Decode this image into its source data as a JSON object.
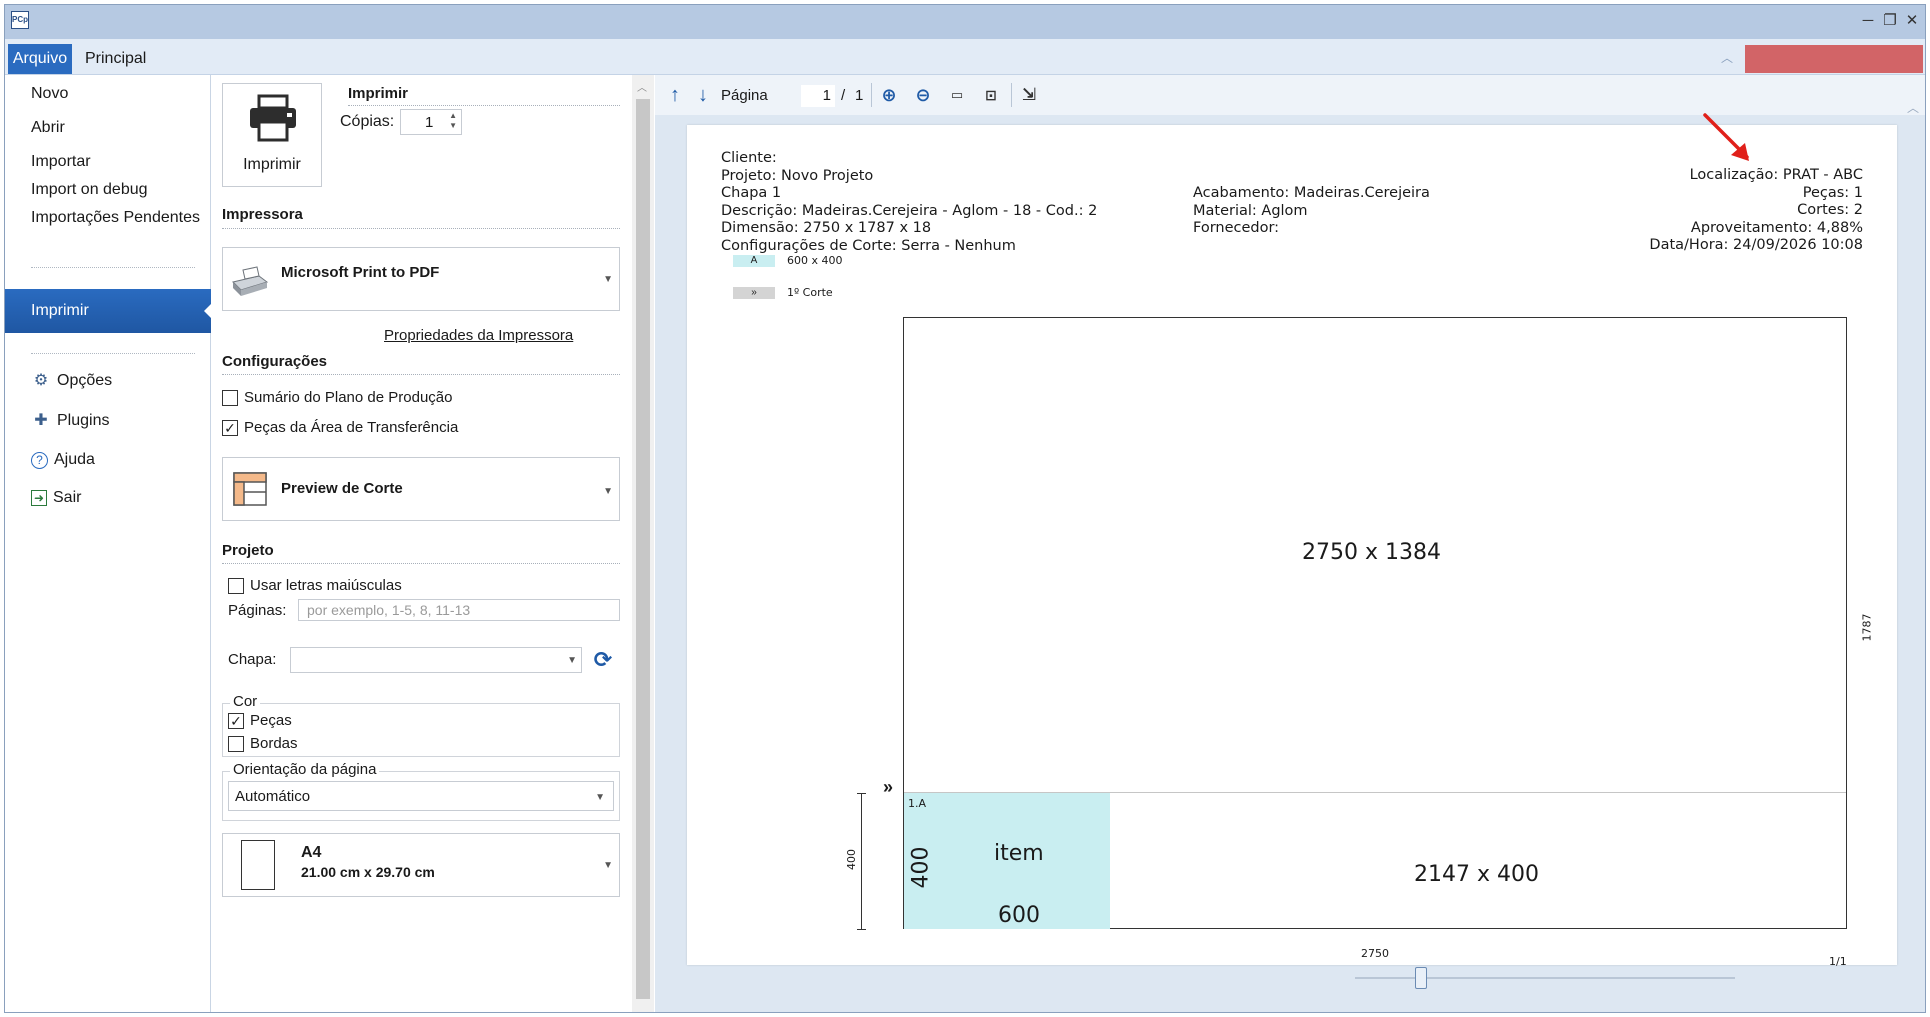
{
  "window": {
    "app_icon_text": "PCp",
    "minimize": "─",
    "restore": "❐",
    "close": "✕"
  },
  "tabs": {
    "arquivo": "Arquivo",
    "principal": "Principal"
  },
  "nav": {
    "novo": "Novo",
    "abrir": "Abrir",
    "importar": "Importar",
    "import_debug": "Import on debug",
    "importacoes_pendentes": "Importações Pendentes",
    "imprimir": "Imprimir",
    "opcoes": "Opções",
    "plugins": "Plugins",
    "ajuda": "Ajuda",
    "sair": "Sair"
  },
  "print_panel": {
    "title": "Imprimir",
    "button_label": "Imprimir",
    "copies_label": "Cópias:",
    "copies_value": "1",
    "printer_heading": "Impressora",
    "printer_name": "Microsoft Print to PDF",
    "printer_properties": "Propriedades da Impressora",
    "config_heading": "Configurações",
    "opt_sumario": "Sumário do Plano de Produção",
    "opt_pecas_transfer": "Peças da Área de Transferência",
    "report_type": "Preview de Corte",
    "project_heading": "Projeto",
    "opt_maiusculas": "Usar letras maiúsculas",
    "paginas_label": "Páginas:",
    "paginas_placeholder": "por exemplo, 1-5, 8, 11-13",
    "chapa_label": "Chapa:",
    "chapa_value": "",
    "cor_title": "Cor",
    "cor_pecas": "Peças",
    "cor_bordas": "Bordas",
    "orientacao_title": "Orientação da página",
    "orientacao_value": "Automático",
    "paper_name": "A4",
    "paper_size": "21.00 cm x 29.70 cm"
  },
  "preview_toolbar": {
    "page_label": "Página",
    "page_current": "1",
    "page_sep": "/",
    "page_total": "1"
  },
  "report": {
    "cliente": "Cliente:",
    "projeto": "Projeto: Novo Projeto",
    "chapa": "Chapa 1",
    "descricao": "Descrição: Madeiras.Cerejeira - Aglom - 18 - Cod.: 2",
    "dimensao": "Dimensão: 2750 x 1787 x 18",
    "config_corte": "Configurações de Corte: Serra - Nenhum",
    "acabamento": "Acabamento: Madeiras.Cerejeira",
    "material": "Material: Aglom",
    "fornecedor": "Fornecedor:",
    "localizacao": "Localização: PRAT - ABC",
    "pecas": "Peças: 1",
    "cortes": "Cortes: 2",
    "aproveitamento": "Aproveitamento: 4,88%",
    "data_hora": "Data/Hora: 24/09/2026 10:08",
    "legend_a_tag": "A",
    "legend_a_text": "600 x 400",
    "legend_cut_tag": "»",
    "legend_cut_text": "1º Corte",
    "region_top_label": "2750 x 1384",
    "region_bottom_label": "2147 x 400",
    "piece_id": "1.A",
    "piece_name": "item",
    "piece_height": "400",
    "piece_width": "600",
    "cut_marker": "»",
    "dim_height": "1787",
    "dim_width": "2750",
    "dim_strip": "400",
    "page_number": "1/1"
  },
  "colors": {
    "accent": "#2a6bc0",
    "piece_fill": "#c9eef1",
    "annotation_arrow": "#e0201a"
  }
}
